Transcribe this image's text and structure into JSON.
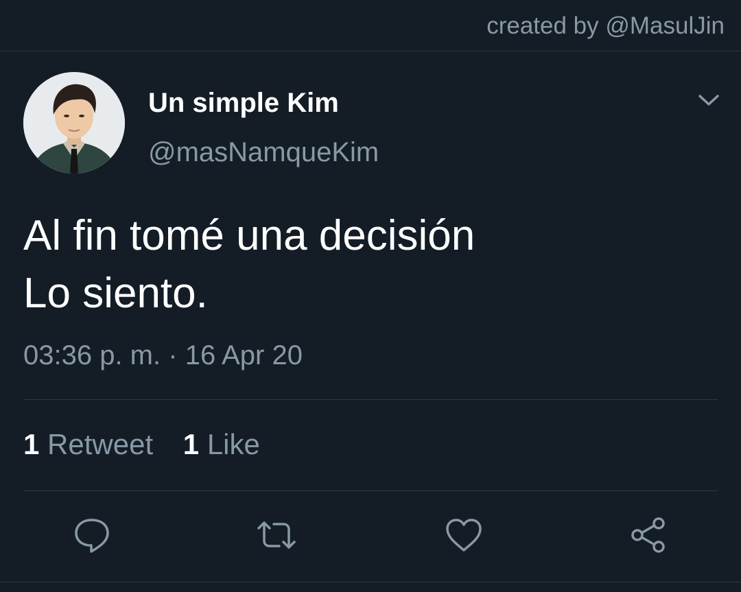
{
  "credit": "created by @MasulJin",
  "tweet": {
    "display_name": "Un simple Kim",
    "handle": "@masNamqueKim",
    "text_lines": [
      "Al fin tomé una decisión",
      "Lo siento."
    ],
    "time": "03:36 p. m.",
    "separator": "·",
    "date": "16 Apr 20"
  },
  "stats": {
    "retweets_count": "1",
    "retweets_label": "Retweet",
    "likes_count": "1",
    "likes_label": "Like"
  },
  "icons": {
    "menu": "chevron-down-icon",
    "reply": "reply-icon",
    "retweet": "retweet-icon",
    "like": "heart-icon",
    "share": "share-icon"
  },
  "colors": {
    "background": "#141d26",
    "secondary_text": "#8899a6",
    "primary_text": "#ffffff",
    "divider": "#2b3844"
  }
}
